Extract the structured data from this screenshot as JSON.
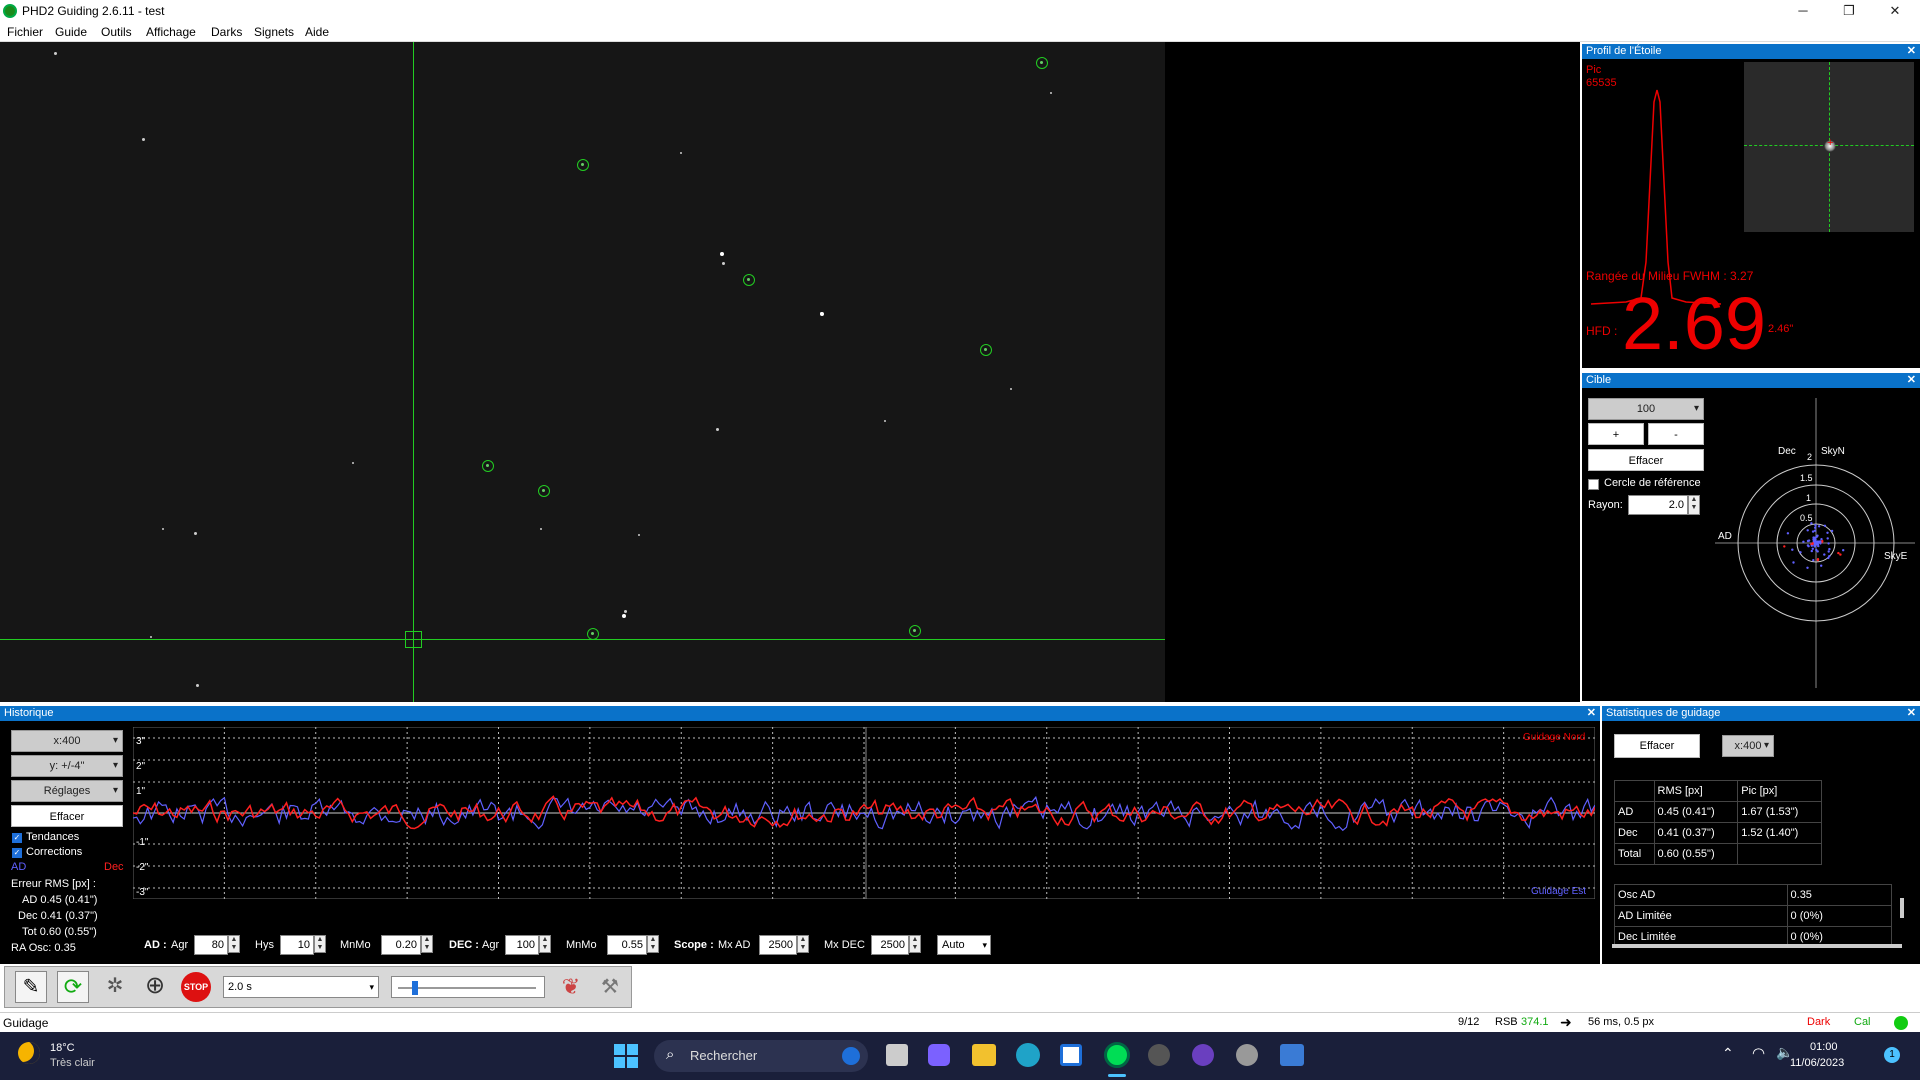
{
  "app": {
    "title": "PHD2 Guiding 2.6.11 - test",
    "win_min": "─",
    "win_max": "❐",
    "win_close": "✕"
  },
  "menu": [
    "Fichier",
    "Guide",
    "Outils",
    "Affichage",
    "Darks",
    "Signets",
    "Aide"
  ],
  "star_profile": {
    "title": "Profil de l'Étoile",
    "pic_label": "Pic",
    "pic_value": "65535",
    "fwhm": "Rangée du Milieu FWHM : 3.27",
    "hfd_label": "HFD :",
    "hfd_value": "2.69",
    "hfd_arcsec": "2.46\""
  },
  "target": {
    "title": "Cible",
    "scale": "100",
    "plus": "+",
    "minus": "-",
    "clear": "Effacer",
    "ref_circle": "Cercle de référence",
    "radius_label": "Rayon:",
    "radius_value": "2.0",
    "labels": {
      "dec": "Dec",
      "skyn": "SkyN",
      "ad": "AD",
      "skye": "SkyE",
      "r2": "2",
      "r15": "1.5",
      "r1": "1",
      "r05": "0.5"
    }
  },
  "history": {
    "title": "Historique",
    "x_combo": "x:400",
    "y_combo": "y: +/-4\"",
    "settings": "Réglages",
    "clear": "Effacer",
    "trends": "Tendances",
    "corrections": "Corrections",
    "ad": "AD",
    "dec": "Dec",
    "rms_title": "Erreur RMS [px] :",
    "rms_ad": "AD  0.45 (0.41\")",
    "rms_dec": "Dec  0.41 (0.37\")",
    "rms_tot": "Tot  0.60 (0.55\")",
    "ra_osc": "RA Osc: 0.35",
    "guide_north": "Guidage Nord",
    "guide_east": "Guidage Est",
    "y_ticks": [
      "3\"",
      "2\"",
      "1\"",
      "-1\"",
      "-2\"",
      "-3\""
    ]
  },
  "params": {
    "ad_label": "AD :",
    "agr_label": "Agr",
    "ad_agr": "80",
    "hys_label": "Hys",
    "hys": "10",
    "mnmo_label": "MnMo",
    "ad_mnmo": "0.20",
    "dec_label": "DEC :",
    "dec_agr": "100",
    "dec_mnmo": "0.55",
    "scope_label": "Scope :",
    "mxad_label": "Mx AD",
    "mxad": "2500",
    "mxdec_label": "Mx DEC",
    "mxdec": "2500",
    "mode": "Auto"
  },
  "guide_stats": {
    "title": "Statistiques de guidage",
    "clear": "Effacer",
    "x_combo": "x:400",
    "headers": [
      "",
      "RMS [px]",
      "Pic [px]"
    ],
    "rows": [
      [
        "AD",
        "0.45 (0.41\")",
        "1.67 (1.53\")"
      ],
      [
        "Dec",
        "0.41 (0.37\")",
        "1.52 (1.40\")"
      ],
      [
        "Total",
        "0.60 (0.55\")",
        ""
      ]
    ],
    "rows2": [
      [
        "Osc AD",
        "0.35"
      ],
      [
        "AD Limitée",
        "0 (0%)"
      ],
      [
        "Dec Limitée",
        "0 (0%)"
      ]
    ]
  },
  "toolbar": {
    "exposure": "2.0 s",
    "stop": "STOP"
  },
  "status": {
    "left": "Guidage",
    "frame": "9/12",
    "rsb_label": "RSB",
    "rsb": "374.1",
    "timing": "56 ms, 0.5 px",
    "dark": "Dark",
    "cal": "Cal"
  },
  "taskbar": {
    "temp": "18°C",
    "weather": "Très clair",
    "search": "Rechercher",
    "time": "01:00",
    "date": "11/06/2023",
    "notif": "1"
  },
  "colors": {
    "accent": "#0a72c9",
    "ra": "#ff2020",
    "dec": "#6060ff",
    "green": "#22cc22"
  }
}
